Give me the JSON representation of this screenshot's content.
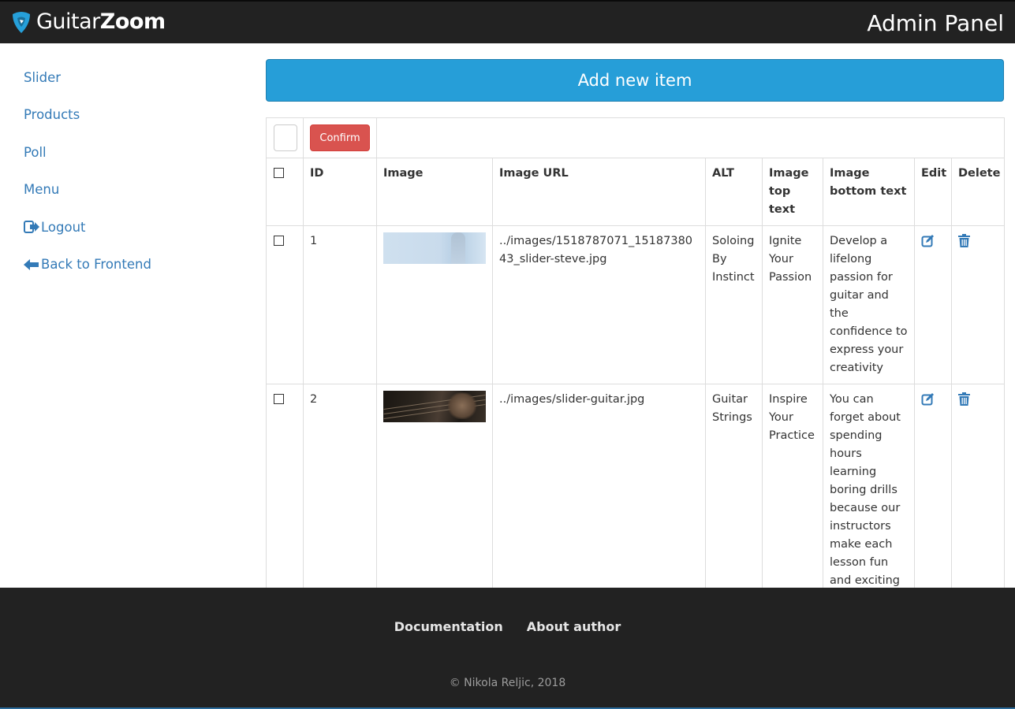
{
  "header": {
    "brand_part1": "Guitar",
    "brand_part2": "Zoom",
    "title": "Admin Panel",
    "logo_icon": "guitar-pick-icon",
    "logo_color": "#26a0da"
  },
  "sidebar": {
    "items": [
      {
        "label": "Slider"
      },
      {
        "label": "Products"
      },
      {
        "label": "Poll"
      },
      {
        "label": "Menu"
      },
      {
        "label": "Logout",
        "icon": "logout-icon"
      },
      {
        "label": "Back to Frontend",
        "icon": "arrow-left-icon"
      }
    ],
    "link_color": "#337ab7"
  },
  "main": {
    "add_button_label": "Add new item",
    "add_button_color": "#269ed8",
    "confirm_label": "Confirm",
    "confirm_color": "#d9534f",
    "columns": [
      "ID",
      "Image",
      "Image URL",
      "ALT",
      "Image top text",
      "Image bottom text",
      "Edit",
      "Delete"
    ],
    "rows": [
      {
        "id": "1",
        "image_icon": "slider-steve-thumbnail",
        "url": "../images/1518787071_1518738043_slider-steve.jpg",
        "alt": "Soloing By Instinct",
        "top_text": "Ignite Your Passion",
        "bottom_text": "Develop a lifelong passion for guitar and the confidence to express your creativity"
      },
      {
        "id": "2",
        "image_icon": "slider-guitar-thumbnail",
        "url": "../images/slider-guitar.jpg",
        "alt": "Guitar Strings",
        "top_text": "Inspire Your Practice",
        "bottom_text": "You can forget about spending hours learning boring drills because our instructors make each lesson fun and exciting"
      }
    ]
  },
  "footer": {
    "links": [
      "Documentation",
      "About author"
    ],
    "copyright": "© Nikola Reljic, 2018"
  }
}
